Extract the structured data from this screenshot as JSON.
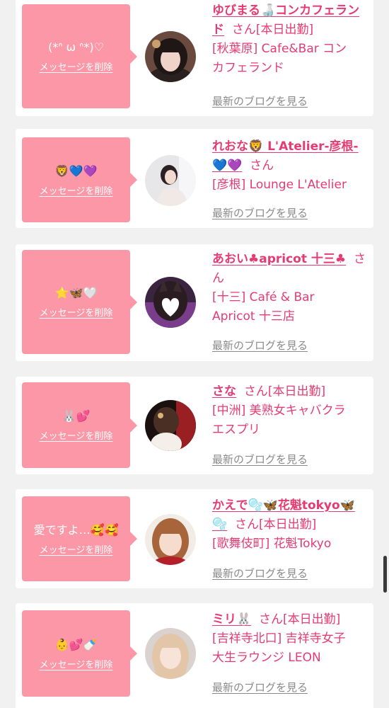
{
  "delete_label": "メッセージを削除",
  "blog_label": "最新のブログを見る",
  "colors": {
    "accent": "#e63b72",
    "bubble": "#fb97a6",
    "background": "#f1f1f1",
    "link_gray": "#8a8a8a"
  },
  "messages": [
    {
      "bubble_text": "(*ᐢ ω ᐢ*)♡",
      "name": "ゆびまる🍶コンカフェランド",
      "san": "さん",
      "status": "[本日出勤]",
      "shop_lines": [
        "[秋葉原] Cafe&Bar コン",
        "カフェランド"
      ],
      "avatar_icon": "girl-photo-avatar"
    },
    {
      "bubble_text": "🦁💙💜",
      "name": "れおな🦁 L'Atelier-彦根-💙💜",
      "san": "さん",
      "status": "",
      "shop_lines": [
        "[彦根] Lounge L'Atelier"
      ],
      "avatar_icon": "girl-photo-avatar"
    },
    {
      "bubble_text": "⭐🦋🤍",
      "name": "あおい♣apricot 十三♣",
      "san": "さん",
      "status": "",
      "shop_lines": [
        "[十三] Café & Bar",
        "Apricot 十三店"
      ],
      "avatar_icon": "girl-photo-avatar"
    },
    {
      "bubble_text": "🐰💕",
      "name": "さな",
      "san": "さん",
      "status": "[本日出勤]",
      "shop_lines": [
        "[中洲] 美熟女キャバクラ",
        "エスプリ"
      ],
      "avatar_icon": "girl-photo-avatar"
    },
    {
      "bubble_text": "愛ですよ…🥰🥰",
      "name": "かえで🫧🦋花魁tokyo🦋🫧",
      "san": "さん",
      "status": "[本日出勤]",
      "shop_lines": [
        "[歌舞伎町] 花魁Tokyo"
      ],
      "avatar_icon": "girl-photo-avatar"
    },
    {
      "bubble_text": "👶💕🍼",
      "name": "ミリ🐰",
      "san": "さん",
      "status": "[本日出勤]",
      "shop_lines": [
        "[吉祥寺北口] 吉祥寺女子",
        "大生ラウンジ LEON"
      ],
      "avatar_icon": "girl-photo-avatar"
    }
  ]
}
